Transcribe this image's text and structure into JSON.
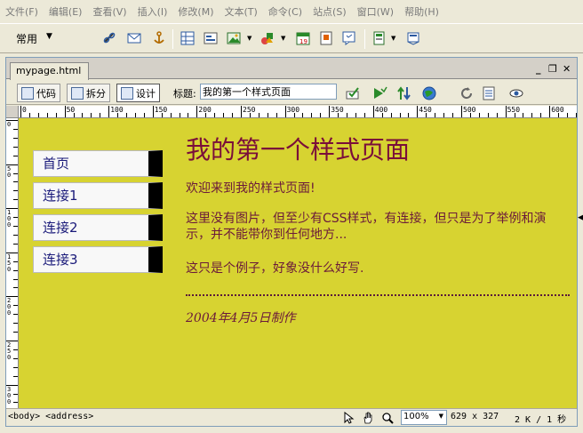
{
  "menubar": {
    "items": [
      "文件(F)",
      "编辑(E)",
      "查看(V)",
      "插入(I)",
      "修改(M)",
      "文本(T)",
      "命令(C)",
      "站点(S)",
      "窗口(W)",
      "帮助(H)"
    ]
  },
  "insertbar": {
    "category": "常用",
    "icons": [
      "hyperlink-icon",
      "email-link-icon",
      "named-anchor-icon",
      "table-icon",
      "layer-icon",
      "image-icon",
      "media-icon",
      "date-icon",
      "comment-icon",
      "tag-chooser-icon",
      "template-icon",
      "head-content-icon"
    ]
  },
  "document": {
    "tab_name": "mypage.html",
    "view_buttons": {
      "code": "代码",
      "split": "拆分",
      "design": "设计"
    },
    "title_label": "标题:",
    "title_value": "我的第一个样式页面"
  },
  "rulers": {
    "h_labels": [
      "0",
      "50",
      "100",
      "150",
      "200",
      "250",
      "300",
      "350",
      "400",
      "450",
      "500",
      "550",
      "600"
    ],
    "v_labels": [
      "0",
      "50",
      "100",
      "150",
      "200",
      "250",
      "300"
    ]
  },
  "page": {
    "nav": [
      "首页",
      "连接1",
      "连接2",
      "连接3"
    ],
    "heading": "我的第一个样式页面",
    "paragraphs": [
      "欢迎来到我的样式页面!",
      "这里没有图片，但至少有CSS样式，有连接，但只是为了举例和演示，并不能带你到任何地方...",
      "这只是个例子，好象没什么好写."
    ],
    "address": "2004年4月5日制作"
  },
  "statusbar": {
    "tag_path": "<body> <address>",
    "zoom": "100%",
    "window_size": "629 x 327",
    "download": "2 K / 1 秒"
  },
  "colors": {
    "canvas_bg": "#d7d331",
    "heading": "#7a0e3a",
    "text": "#6b1a3a"
  }
}
